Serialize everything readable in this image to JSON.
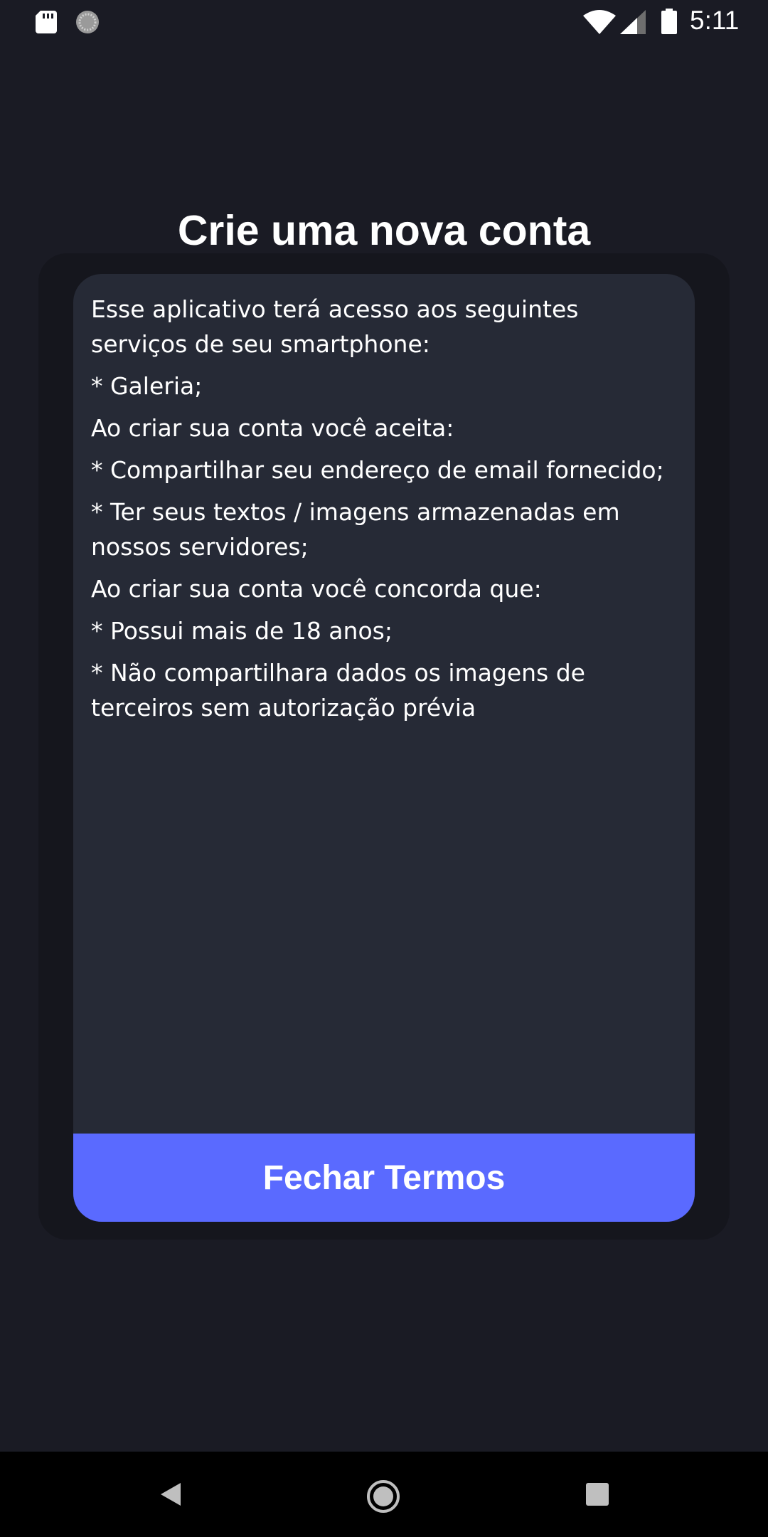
{
  "status_bar": {
    "time": "5:11",
    "icons": [
      "sd-card-icon",
      "sync-icon",
      "wifi-icon",
      "signal-icon",
      "battery-icon"
    ]
  },
  "screen": {
    "title": "Crie uma nova conta"
  },
  "terms_modal": {
    "paragraphs": [
      "Esse aplicativo terá acesso aos seguintes serviços de seu smartphone:",
      "* Galeria;",
      "Ao criar sua conta você aceita:",
      "* Compartilhar seu endereço de email fornecido;",
      "* Ter seus textos / imagens armazenadas em nossos servidores;",
      "Ao criar sua conta você concorda que:",
      "* Possui mais de 18 anos;",
      "* Não compartilhara dados os imagens de terceiros sem autorização prévia"
    ],
    "close_button_label": "Fechar Termos"
  },
  "colors": {
    "background": "#1a1b24",
    "card": "#262a36",
    "accent": "#5a6aff",
    "text": "#ffffff"
  },
  "nav_bar": {
    "icons": [
      "back-icon",
      "home-icon",
      "recents-icon"
    ]
  }
}
